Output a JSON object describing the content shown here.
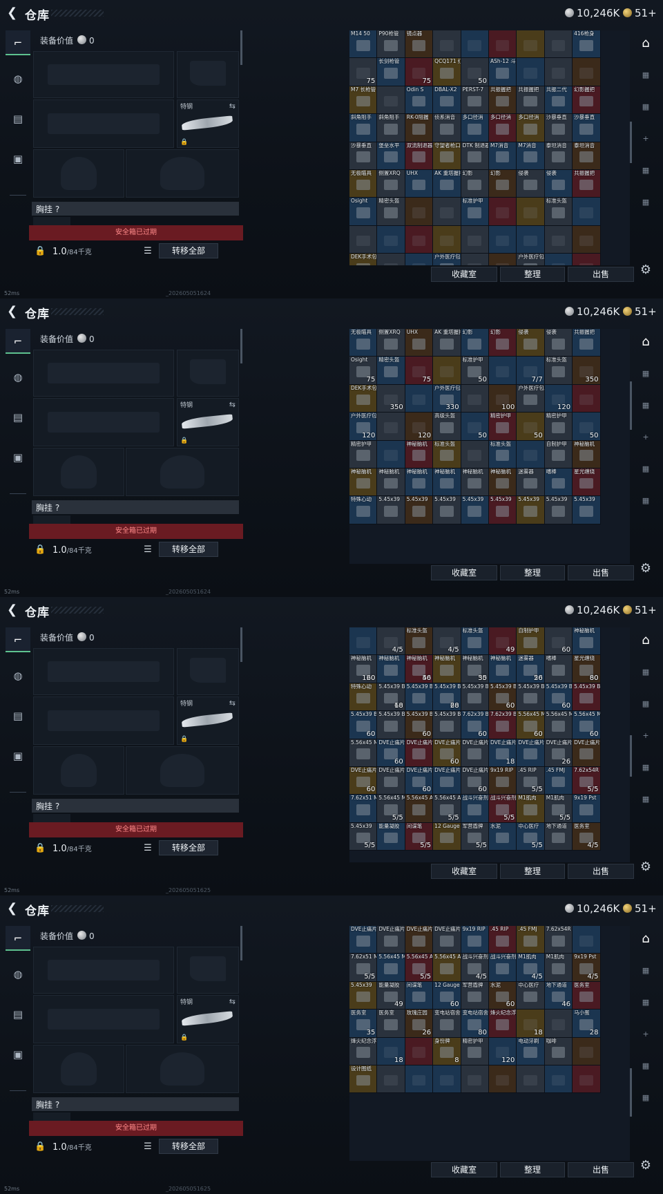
{
  "screen": {
    "title": "仓库",
    "currency": {
      "silver": "10,246K",
      "gold": "51+"
    },
    "loadout": {
      "worth_label": "装备价值",
      "worth_value": "0",
      "melee_label": "特钢",
      "chest_label": "胸挂 ?",
      "safe_box_status": "安全箱已过期",
      "weight_value": "1.0",
      "weight_cap": "/84千克",
      "transfer_all": "转移全部"
    },
    "stash_actions": {
      "favorites": "收藏室",
      "sort": "整理",
      "sell": "出售"
    },
    "status_ping": "52ms"
  },
  "frames": [
    {
      "timestamp": "_202605051624",
      "cells": [
        [
          "M14 50",
          ""
        ],
        [
          "P90枪管",
          ""
        ],
        [
          "镜点器",
          ""
        ],
        [
          "",
          ""
        ],
        [
          "",
          ""
        ],
        [
          "",
          ""
        ],
        [
          "",
          ""
        ],
        [
          "",
          ""
        ],
        [
          "416枪身",
          ""
        ],
        [
          "",
          ""
        ],
        [
          "长剑枪管",
          ""
        ],
        [
          "",
          ""
        ],
        [
          "QCQ171 红缨长枪管",
          ""
        ],
        [
          "",
          ""
        ],
        [
          "ASh-12 斗兵长枪管",
          ""
        ],
        [
          "",
          ""
        ],
        [
          "",
          ""
        ],
        [
          "",
          ""
        ],
        [
          "M7 长枪管",
          ""
        ],
        [
          "",
          ""
        ],
        [
          "Odin S",
          ""
        ],
        [
          "DBAL-X2",
          ""
        ],
        [
          "PERST-7",
          ""
        ],
        [
          "共振握把",
          ""
        ],
        [
          "共振握把",
          ""
        ],
        [
          "共振二代",
          ""
        ],
        [
          "幻影握把",
          ""
        ],
        [
          "斜角阻手",
          ""
        ],
        [
          "斜角阻手",
          ""
        ],
        [
          "RK-0阻握",
          ""
        ],
        [
          "侦系消音",
          ""
        ],
        [
          "多口径消",
          ""
        ],
        [
          "多口径消",
          ""
        ],
        [
          "多口径消",
          ""
        ],
        [
          "沙暴垂直",
          ""
        ],
        [
          "沙暴垂直",
          ""
        ],
        [
          "沙暴垂直",
          ""
        ],
        [
          "堡垒水平",
          ""
        ],
        [
          "双流制退器",
          ""
        ],
        [
          "守望者枪口",
          ""
        ],
        [
          "DTK 制退器",
          ""
        ],
        [
          "M7消音",
          ""
        ],
        [
          "M7消音",
          ""
        ],
        [
          "泰坦消音",
          ""
        ],
        [
          "泰坦消音",
          ""
        ],
        [
          "无极瞄具",
          ""
        ],
        [
          "侧置XRQ",
          ""
        ],
        [
          "UHX",
          ""
        ],
        [
          "AK 重塔握把",
          ""
        ],
        [
          "幻影",
          ""
        ],
        [
          "幻影",
          ""
        ],
        [
          "侵袭",
          ""
        ],
        [
          "侵袭",
          ""
        ],
        [
          "共振握把",
          ""
        ],
        [
          "Osight",
          ""
        ],
        [
          "精密头盔",
          ""
        ],
        [
          "",
          ""
        ],
        [
          "",
          ""
        ],
        [
          "标准护甲",
          ""
        ],
        [
          "",
          ""
        ],
        [
          "",
          ""
        ],
        [
          "标准头盔",
          ""
        ],
        [
          "",
          ""
        ],
        [
          "",
          ""
        ],
        [
          "",
          ""
        ],
        [
          "",
          ""
        ],
        [
          "",
          ""
        ],
        [
          "",
          ""
        ],
        [
          "",
          ""
        ],
        [
          "",
          ""
        ],
        [
          "",
          ""
        ],
        [
          "",
          ""
        ],
        [
          "DEK手术包",
          ""
        ],
        [
          "",
          ""
        ],
        [
          "",
          ""
        ],
        [
          "户外医疗包",
          ""
        ],
        [
          "",
          ""
        ],
        [
          "",
          ""
        ],
        [
          "户外医疗包",
          ""
        ],
        [
          "",
          ""
        ],
        [
          "",
          ""
        ]
      ],
      "counts": {
        "helmet1": "75",
        "armor1": "75",
        "helmet2": "50"
      }
    },
    {
      "timestamp": "_202605051624",
      "labels": {
        "r0": [
          "无极瞄具",
          "侧置XRQ",
          "UHX",
          "AK 重塔握把",
          "幻影",
          "幻影",
          "侵袭",
          "侵袭",
          "共振握把"
        ],
        "r1": [
          "Osight",
          "精密头盔",
          "",
          "",
          "标准护甲",
          "",
          "",
          "标准头盔",
          ""
        ],
        "r2": [
          "DEK手术包",
          "",
          "",
          "户外医疗包",
          "",
          "",
          "户外医疗包",
          "",
          ""
        ],
        "r3": [
          "户外医疗包",
          "",
          "",
          "高级头盔",
          "",
          "精密护甲",
          "",
          "精密护甲",
          ""
        ],
        "r4": [
          "精密护甲",
          "",
          "神秘脑机",
          "标准头盔",
          "",
          "标准头盔",
          "",
          "自制护甲",
          "神秘脑机"
        ],
        "r5": [
          "神秘脑机",
          "神秘脑机",
          "神秘脑机",
          "神秘脑机",
          "神秘脑机",
          "神秘脑机",
          "迷雾器",
          "嗜棒",
          "星光缠绕"
        ],
        "r6": [
          "特殊心动",
          "5.45x39",
          "5.45x39",
          "5.45x39",
          "5.45x39",
          "5.45x39",
          "5.45x39",
          "5.45x39",
          "5.45x39"
        ]
      },
      "counts": [
        "75",
        "75",
        "50",
        "7/7",
        "350",
        "350",
        "330",
        "100",
        "120",
        "120",
        "120",
        "50",
        "50",
        "50"
      ]
    },
    {
      "timestamp": "_202605051625",
      "labels": {
        "r0": [
          "",
          "",
          "标准头盔",
          "",
          "标准头盔",
          "",
          "自制护甲",
          "",
          "神秘脑机"
        ],
        "r1": [
          "神秘脑机",
          "神秘脑机",
          "神秘脑机",
          "神秘脑机",
          "神秘脑机",
          "神秘脑机",
          "迷雾器",
          "嗜棒",
          "星光缠绕"
        ],
        "r2": [
          "特殊心动",
          "5.45x39 BT",
          "5.45x39 BT",
          "5.45x39 BT",
          "5.45x39 BT",
          "5.45x39 BT",
          "5.45x39 BT",
          "5.45x39 BT",
          "5.45x39 BT"
        ],
        "r3": [
          "5.45x39 BT",
          "5.45x39 BT",
          "5.45x39 BT",
          "5.45x39 BT",
          "7.62x39 BP",
          "7.62x39 BP",
          "5.56x45 M855A1",
          "5.56x45 M855A1",
          "5.56x45 M855A1"
        ],
        "r4": [
          "5.56x45 M855A1",
          "DVE止痛片",
          "DVE止痛片",
          "DVE止痛片",
          "DVE止痛片",
          "DVE止痛片",
          "DVE止痛片",
          "DVE止痛片",
          "DVE止痛片"
        ],
        "r5": [
          "DVE止痛片",
          "DVE止痛片",
          "DVE止痛片",
          "DVE止痛片",
          "DVE止痛片",
          "9x19 RIP",
          ".45 RIP",
          ".45 FMJ",
          "7.62x54R T46M"
        ],
        "r6": [
          "7.62x51 M80",
          "5.56x45 M855",
          "5.56x45 AP",
          "5.56x45 AP",
          "战斗兴奋剂",
          "战斗兴奋剂",
          "M1肌肉",
          "M1肌肉",
          "9x19 Pst"
        ],
        "r7": [
          "5.45x39",
          "能量凝胶",
          "间谍笔",
          "12 Gauge",
          "军营盾牌",
          "水泥",
          "中心医疗",
          "地下通道",
          "医务室"
        ]
      },
      "counts": [
        "120",
        "50",
        "50",
        "50",
        "60",
        "60",
        "60",
        "60",
        "60",
        "60",
        "60",
        "60",
        "60",
        "60",
        "60",
        "60",
        "18",
        "26",
        "60",
        "60",
        "60",
        "5/5",
        "5/5",
        "5/5",
        "5/5",
        "5/5",
        "5/5",
        "5/5",
        "5/5",
        "5/5",
        "5/5",
        "4/5",
        "4/5",
        "4/5",
        "49",
        "60",
        "60",
        "46",
        "35",
        "26",
        "80",
        "18",
        "28"
      ]
    },
    {
      "timestamp": "_202605051625",
      "labels": {
        "r0": [
          "DVE止痛片",
          "DVE止痛片",
          "DVE止痛片",
          "DVE止痛片",
          "9x19 RIP",
          ".45 RIP",
          ".45 FMJ",
          "7.62x54R T46M",
          ""
        ],
        "r1": [
          "7.62x51 M80",
          "5.56x45 M855",
          "5.56x45 AP",
          "5.56x45 AP",
          "战斗兴奋剂",
          "战斗兴奋剂",
          "M1肌肉",
          "M1肌肉",
          "9x19 Pst"
        ],
        "r2": [
          "5.45x39",
          "能量凝胶",
          "间谍笔",
          "12 Gauge",
          "军营盾牌",
          "水泥",
          "中心医疗",
          "地下通道",
          "医务室"
        ],
        "r3": [
          "医务室",
          "医务室",
          "玫瑰庄园",
          "变电站宿舍",
          "变电站宿舍",
          "烽火纪念浮杯",
          "",
          "",
          "马小蛋"
        ],
        "r4": [
          "烽火纪念浮杯",
          "",
          "",
          "身份牌",
          "精密护甲",
          "",
          "电动牙刷",
          "咖啡",
          ""
        ],
        "r5": [
          "设计图纸",
          "",
          "",
          "",
          "",
          "",
          "",
          "",
          ""
        ]
      },
      "counts": [
        "5/5",
        "5/5",
        "4/5",
        "4/5",
        "4/5",
        "49",
        "60",
        "60",
        "46",
        "35",
        "26",
        "80",
        "18",
        "28",
        "18",
        "8",
        "120"
      ]
    }
  ]
}
